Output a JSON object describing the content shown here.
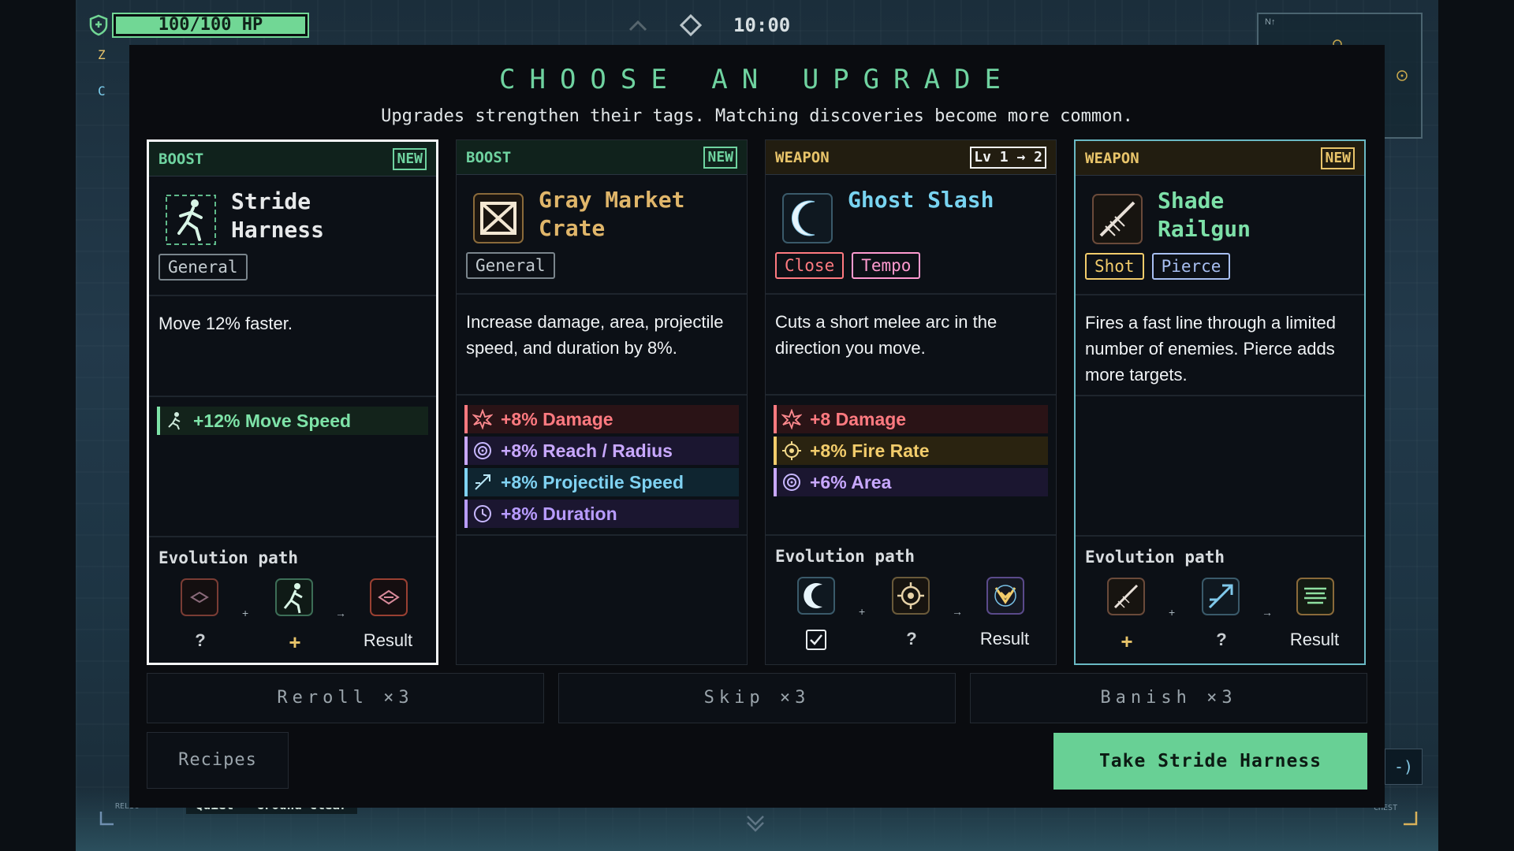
{
  "hud": {
    "hp_text": "100/100 HP",
    "time": "10:00",
    "status_chip": "Quiet · Ground clear",
    "side_glyph_1": "Z",
    "side_glyph_2": "C",
    "minimap_north": "N↑",
    "corner_left_tag": "RELIC",
    "corner_right_tag": "CHEST",
    "hint_key": "-)"
  },
  "modal": {
    "title": "CHOOSE AN UPGRADE",
    "subtitle": "Upgrades strengthen their tags. Matching discoveries become more common."
  },
  "cards": [
    {
      "type": "BOOST",
      "badge": "NEW",
      "name_line1": "Stride",
      "name_line2": "Harness",
      "icon": "running-figure-icon",
      "tags": [
        "General"
      ],
      "description": "Move 12% faster.",
      "stats": [
        {
          "label": "+12% Move Speed",
          "icon": "speed-icon",
          "color": "#7ee3a8"
        }
      ],
      "evolution": {
        "title": "Evolution path",
        "slot1_label": "?",
        "slot2_label": "+",
        "result_label": "Result",
        "plus": "+",
        "arrow": "→"
      }
    },
    {
      "type": "BOOST",
      "badge": "NEW",
      "name_line1": "Gray Market",
      "name_line2": "Crate",
      "icon": "crate-icon",
      "tags": [
        "General"
      ],
      "description": "Increase damage, area, projectile speed, and duration by 8%.",
      "stats": [
        {
          "label": "+8% Damage",
          "icon": "damage-icon",
          "color": "#ff7a80"
        },
        {
          "label": "+8% Reach / Radius",
          "icon": "radius-icon",
          "color": "#c8a8ff"
        },
        {
          "label": "+8% Projectile Speed",
          "icon": "projectile-icon",
          "color": "#7fd2f2"
        },
        {
          "label": "+8% Duration",
          "icon": "clock-icon",
          "color": "#b89cff"
        }
      ]
    },
    {
      "type": "WEAPON",
      "badge": "Lv 1 → 2",
      "name_line1": "Ghost Slash",
      "name_line2": "",
      "icon": "crescent-slash-icon",
      "tags": [
        "Close",
        "Tempo"
      ],
      "description": "Cuts a short melee arc in the direction you move.",
      "stats": [
        {
          "label": "+8 Damage",
          "icon": "damage-icon",
          "color": "#ff7a80"
        },
        {
          "label": "+8% Fire Rate",
          "icon": "fire-rate-icon",
          "color": "#f2cc6b"
        },
        {
          "label": "+6% Area",
          "icon": "radius-icon",
          "color": "#c8a8ff"
        }
      ],
      "evolution": {
        "title": "Evolution path",
        "slot2_label": "?",
        "result_label": "Result",
        "plus": "+",
        "arrow": "→"
      }
    },
    {
      "type": "WEAPON",
      "badge": "NEW",
      "name_line1": "Shade",
      "name_line2": "Railgun",
      "icon": "railgun-icon",
      "tags": [
        "Shot",
        "Pierce"
      ],
      "description": "Fires a fast line through a limited number of enemies. Pierce adds more targets.",
      "stats": [],
      "evolution": {
        "title": "Evolution path",
        "slot1_label": "+",
        "slot2_label": "?",
        "result_label": "Result",
        "plus": "+",
        "arrow": "→"
      }
    }
  ],
  "actions": {
    "reroll": "Reroll ×3",
    "skip": "Skip ×3",
    "banish": "Banish ×3",
    "recipes": "Recipes",
    "take": "Take Stride Harness"
  },
  "colors": {
    "accent": "#68d095",
    "boost": "#6fd3a0",
    "weapon": "#e8c46a",
    "name_boost_1": "#e7e9ea",
    "name_boost_2": "#e0b66a",
    "name_weapon_1": "#78d3f0",
    "name_weapon_2": "#7de0a8"
  }
}
